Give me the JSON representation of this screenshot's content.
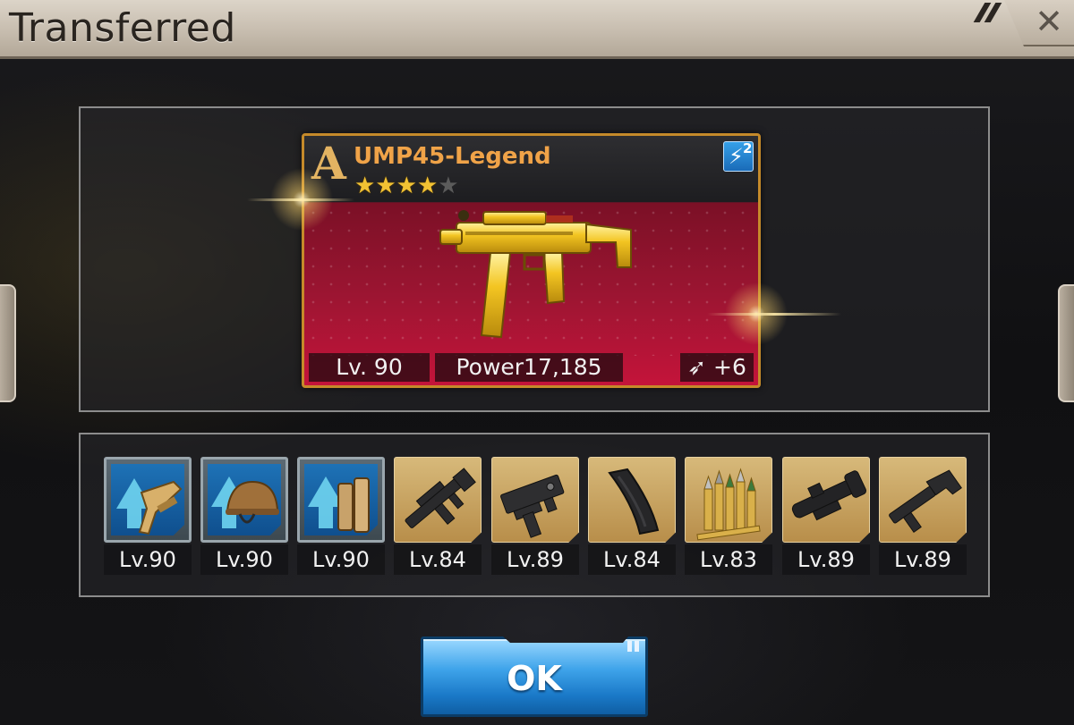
{
  "dialog": {
    "title": "Transferred",
    "ok_label": "OK"
  },
  "weapon": {
    "grade": "A",
    "name": "UMP45-Legend",
    "stars_filled": 4,
    "stars_total": 5,
    "skill_count": "2",
    "level": "Lv. 90",
    "power": "Power17,185",
    "ammo": "+6",
    "colors": {
      "name": "#f0a348",
      "frame": "#c58a2a",
      "background": "#9d1532"
    }
  },
  "parts": [
    {
      "icon": "stock-upgrade-icon",
      "style": "blue",
      "level": "Lv.90"
    },
    {
      "icon": "helmet-upgrade-icon",
      "style": "blue",
      "level": "Lv.90"
    },
    {
      "icon": "magazine-upgrade-icon",
      "style": "blue",
      "level": "Lv.90"
    },
    {
      "icon": "rifle-icon",
      "style": "gold",
      "level": "Lv.84"
    },
    {
      "icon": "receiver-icon",
      "style": "gold",
      "level": "Lv.89"
    },
    {
      "icon": "magazine-icon",
      "style": "gold",
      "level": "Lv.84"
    },
    {
      "icon": "ammo-icon",
      "style": "gold",
      "level": "Lv.83"
    },
    {
      "icon": "scope-icon",
      "style": "gold",
      "level": "Lv.89"
    },
    {
      "icon": "stock-icon",
      "style": "gold",
      "level": "Lv.89"
    }
  ]
}
